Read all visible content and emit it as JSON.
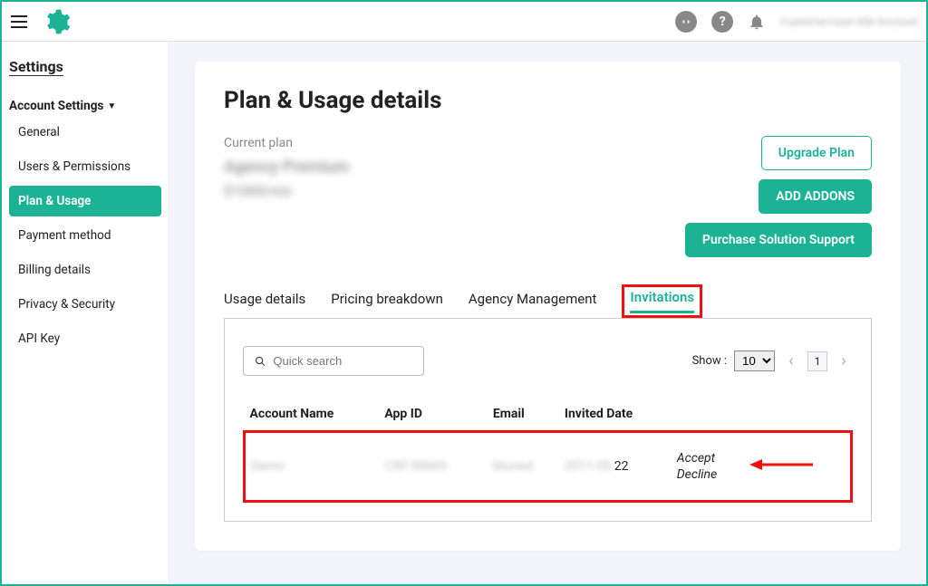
{
  "topbar": {
    "user_blur": "Customer/user title Account"
  },
  "sidebar": {
    "title": "Settings",
    "group_label": "Account Settings",
    "items": [
      {
        "label": "General"
      },
      {
        "label": "Users & Permissions"
      },
      {
        "label": "Plan & Usage"
      },
      {
        "label": "Payment method"
      },
      {
        "label": "Billing details"
      },
      {
        "label": "Privacy & Security"
      },
      {
        "label": "API Key"
      }
    ]
  },
  "page": {
    "title": "Plan & Usage details",
    "current_plan_label": "Current plan",
    "plan_name_blur": "Agency Premium",
    "plan_extra_blur": "$1000/mo"
  },
  "actions": {
    "upgrade": "Upgrade Plan",
    "add_addons": "ADD ADDONS",
    "purchase_support": "Purchase Solution Support"
  },
  "tabs": {
    "usage_details": "Usage details",
    "pricing_breakdown": "Pricing breakdown",
    "agency_management": "Agency Management",
    "invitations": "Invitations"
  },
  "list": {
    "search_placeholder": "Quick search",
    "show_label": "Show :",
    "page_size": "10",
    "page_num": "1",
    "columns": {
      "account_name": "Account Name",
      "app_id": "App ID",
      "email": "Email",
      "invited_date": "Invited Date"
    },
    "row": {
      "account_name_blur": "Demo",
      "app_id_blur": "CXF:58665-",
      "email_blur": "blurred",
      "invited_date_partial": "22"
    },
    "accept": "Accept",
    "decline": "Decline"
  }
}
